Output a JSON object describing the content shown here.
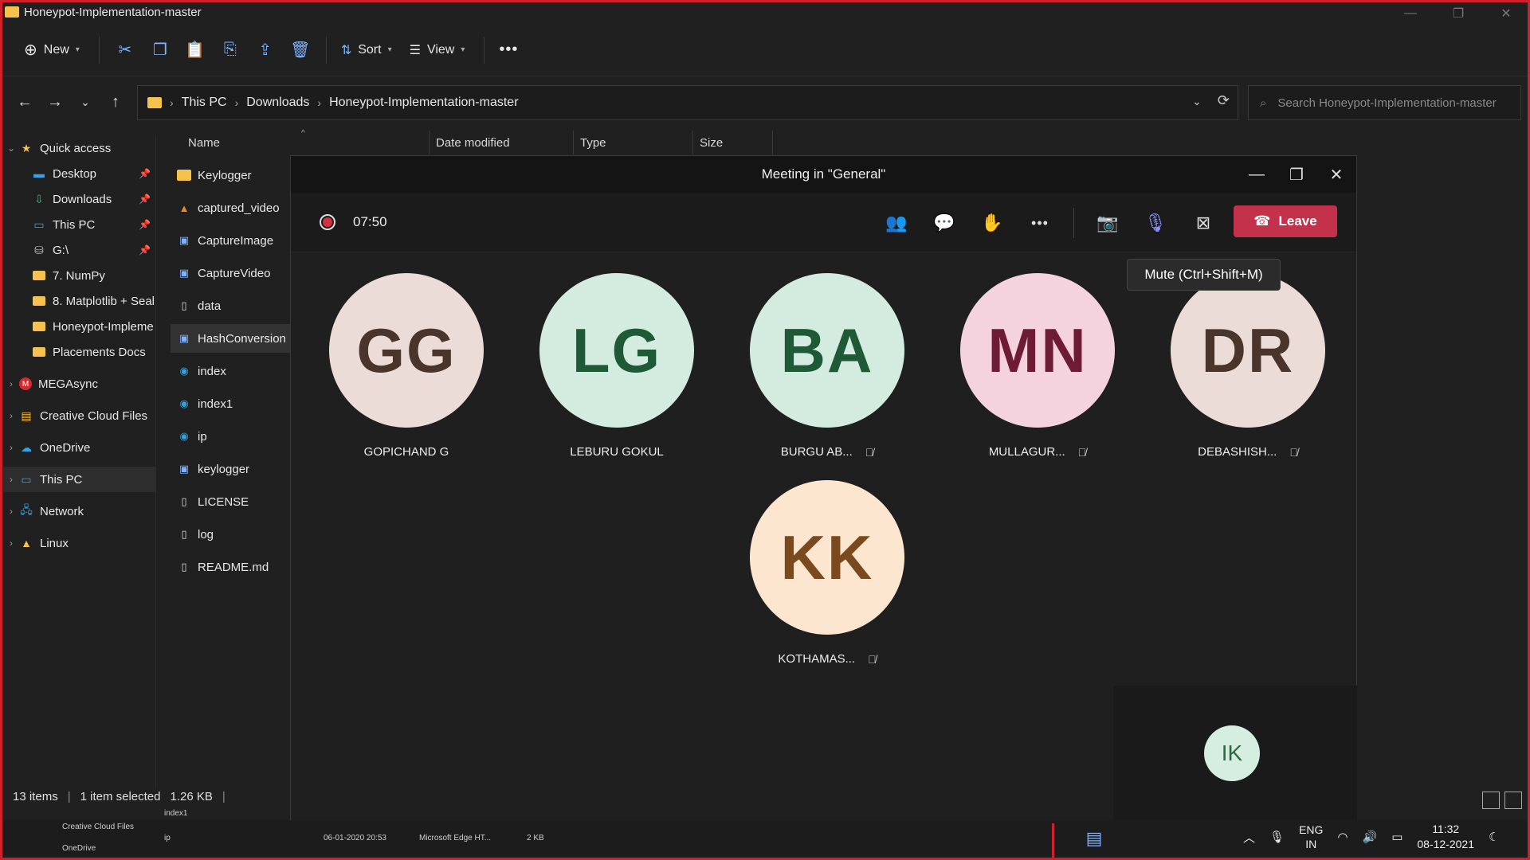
{
  "window": {
    "title": "Honeypot-Implementation-master"
  },
  "toolbar": {
    "new_label": "New",
    "sort_label": "Sort",
    "view_label": "View"
  },
  "address": {
    "crumbs": [
      "This PC",
      "Downloads",
      "Honeypot-Implementation-master"
    ]
  },
  "search": {
    "placeholder": "Search Honeypot-Implementation-master"
  },
  "sidebar": {
    "items": [
      {
        "label": "Quick access",
        "icon": "star-icon"
      },
      {
        "label": "Desktop",
        "icon": "desktop-icon"
      },
      {
        "label": "Downloads",
        "icon": "download-icon"
      },
      {
        "label": "This PC",
        "icon": "pc-icon"
      },
      {
        "label": "G:\\",
        "icon": "drive-icon"
      },
      {
        "label": "7. NumPy",
        "icon": "folder-icon"
      },
      {
        "label": "8. Matplotlib + Seal",
        "icon": "folder-icon"
      },
      {
        "label": "Honeypot-Impleme",
        "icon": "folder-icon"
      },
      {
        "label": "Placements Docs",
        "icon": "folder-icon"
      },
      {
        "label": "MEGAsync",
        "icon": "mega-icon"
      },
      {
        "label": "Creative Cloud Files",
        "icon": "creative-cloud-icon"
      },
      {
        "label": "OneDrive",
        "icon": "cloud-icon"
      },
      {
        "label": "This PC",
        "icon": "pc-icon"
      },
      {
        "label": "Network",
        "icon": "network-icon"
      },
      {
        "label": "Linux",
        "icon": "linux-icon"
      }
    ]
  },
  "columns": {
    "name": "Name",
    "date": "Date modified",
    "type": "Type",
    "size": "Size"
  },
  "files": [
    {
      "name": "Keylogger",
      "icon": "folder-icon"
    },
    {
      "name": "captured_video",
      "icon": "vlc-icon"
    },
    {
      "name": "CaptureImage",
      "icon": "python-file-icon"
    },
    {
      "name": "CaptureVideo",
      "icon": "python-file-icon"
    },
    {
      "name": "data",
      "icon": "file-icon"
    },
    {
      "name": "HashConversion",
      "icon": "python-file-icon"
    },
    {
      "name": "index",
      "icon": "edge-icon"
    },
    {
      "name": "index1",
      "icon": "edge-icon"
    },
    {
      "name": "ip",
      "icon": "edge-icon"
    },
    {
      "name": "keylogger",
      "icon": "python-file-icon"
    },
    {
      "name": "LICENSE",
      "icon": "file-icon"
    },
    {
      "name": "log",
      "icon": "file-icon"
    },
    {
      "name": "README.md",
      "icon": "file-icon"
    }
  ],
  "status": {
    "count": "13 items",
    "selected": "1 item selected",
    "size": "1.26 KB"
  },
  "meeting": {
    "title": "Meeting in \"General\"",
    "timer": "07:50",
    "leave_label": "Leave",
    "tooltip": "Mute (Ctrl+Shift+M)",
    "participants": [
      {
        "initials": "GG",
        "name": "GOPICHAND G",
        "muted": false,
        "bg": "#ecdcd7",
        "fg": "#4a352d"
      },
      {
        "initials": "LG",
        "name": "LEBURU GOKUL",
        "muted": false,
        "bg": "#d3ecdf",
        "fg": "#1f5a37"
      },
      {
        "initials": "BA",
        "name": "BURGU AB...",
        "muted": true,
        "bg": "#d3ecdf",
        "fg": "#1f5a37"
      },
      {
        "initials": "MN",
        "name": "MULLAGUR...",
        "muted": true,
        "bg": "#f4d2de",
        "fg": "#6e1b36"
      },
      {
        "initials": "DR",
        "name": "DEBASHISH...",
        "muted": true,
        "bg": "#ecdcd7",
        "fg": "#4a352d"
      },
      {
        "initials": "KK",
        "name": "KOTHAMAS...",
        "muted": true,
        "bg": "#fde6cf",
        "fg": "#7a4a1e"
      }
    ],
    "self": {
      "initials": "IK"
    }
  },
  "taskbar": {
    "lang1": "ENG",
    "lang2": "IN",
    "time": "11:32",
    "date": "08-12-2021",
    "mini": {
      "index1": "index1",
      "cc": "Creative Cloud Files",
      "onedrive": "OneDrive",
      "ip": "ip",
      "date": "06-01-2020 20:53",
      "type": "Microsoft Edge HT...",
      "size": "2 KB"
    }
  },
  "colors": {
    "leave": "#c4314b",
    "accent": "#8c92ff",
    "frame": "#d0202a"
  }
}
